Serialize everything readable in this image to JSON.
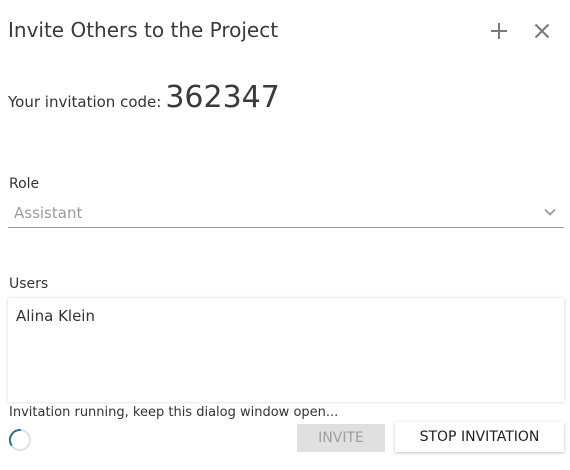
{
  "dialog": {
    "title": "Invite Others to the Project",
    "add_icon": "plus-icon",
    "close_icon": "close-icon"
  },
  "invitation": {
    "code_label": "Your invitation code:",
    "code": "362347"
  },
  "role": {
    "label": "Role",
    "selected": "Assistant",
    "chevron_icon": "chevron-down-icon"
  },
  "users": {
    "label": "Users",
    "items": [
      "Alina Klein"
    ]
  },
  "status": {
    "text": "Invitation running, keep this dialog window open...",
    "spinner_icon": "spinner-icon"
  },
  "actions": {
    "invite_label": "INVITE",
    "stop_label": "STOP INVITATION"
  },
  "colors": {
    "text": "#333333",
    "muted": "#9b9b9b",
    "disabled_bg": "#e0e0e0",
    "spinner": "#2f6f8a"
  }
}
